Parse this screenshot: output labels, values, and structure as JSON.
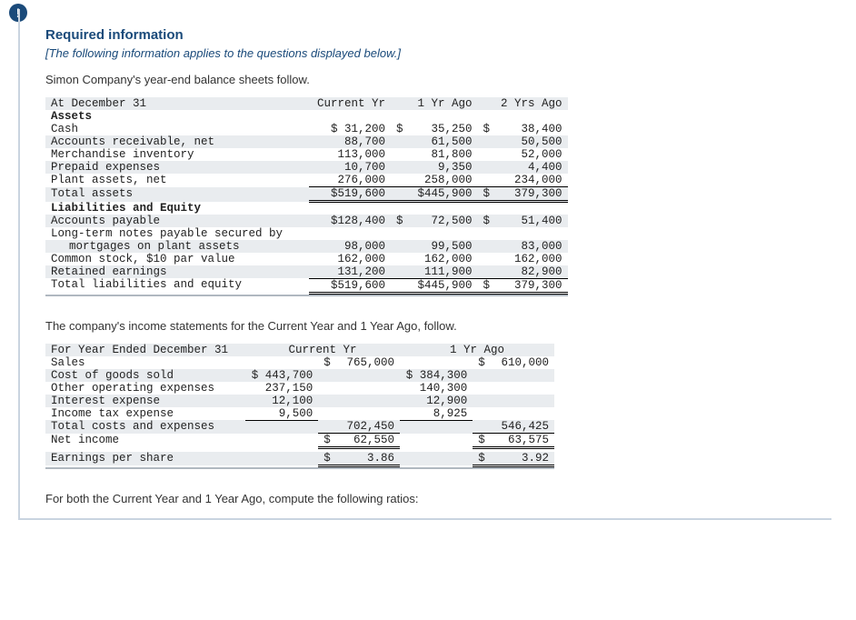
{
  "icon": "!",
  "title": "Required information",
  "intro": "[The following information applies to the questions displayed below.]",
  "lead1": "Simon Company's year-end balance sheets follow.",
  "bs": {
    "header": "At December 31",
    "cols": {
      "c1": "Current Yr",
      "c2": "1 Yr Ago",
      "c3": "2 Yrs Ago"
    },
    "assets_hdr": "Assets",
    "cash_lbl": "Cash",
    "cash": {
      "c1": "31,200",
      "c2": "35,250",
      "c3": "38,400"
    },
    "ar_lbl": "Accounts receivable, net",
    "ar": {
      "c1": "88,700",
      "c2": "61,500",
      "c3": "50,500"
    },
    "inv_lbl": "Merchandise inventory",
    "inv": {
      "c1": "113,000",
      "c2": "81,800",
      "c3": "52,000"
    },
    "pre_lbl": "Prepaid expenses",
    "pre": {
      "c1": "10,700",
      "c2": "9,350",
      "c3": "4,400"
    },
    "pa_lbl": "Plant assets, net",
    "pa": {
      "c1": "276,000",
      "c2": "258,000",
      "c3": "234,000"
    },
    "ta_lbl": "Total assets",
    "ta": {
      "c1": "$519,600",
      "c2": "$445,900",
      "c3": "379,300"
    },
    "le_hdr": "Liabilities and Equity",
    "ap_lbl": "Accounts payable",
    "ap": {
      "c1": "$128,400",
      "c2": "72,500",
      "c3": "51,400"
    },
    "ltn_lbl1": "Long-term notes payable secured by",
    "ltn_lbl2": "mortgages on plant assets",
    "ltn": {
      "c1": "98,000",
      "c2": "99,500",
      "c3": "83,000"
    },
    "cs_lbl": "Common stock, $10 par value",
    "cs": {
      "c1": "162,000",
      "c2": "162,000",
      "c3": "162,000"
    },
    "re_lbl": "Retained earnings",
    "re": {
      "c1": "131,200",
      "c2": "111,900",
      "c3": "82,900"
    },
    "tle_lbl": "Total liabilities and equity",
    "tle": {
      "c1": "$519,600",
      "c2": "$445,900",
      "c3": "379,300"
    }
  },
  "lead2": "The company's income statements for the Current Year and 1 Year Ago, follow.",
  "is": {
    "header": "For Year Ended December 31",
    "cols": {
      "c1": "Current Yr",
      "c2": "1 Yr Ago"
    },
    "sales_lbl": "Sales",
    "sales": {
      "c1": "765,000",
      "c2": "610,000"
    },
    "cogs_lbl": "Cost of goods sold",
    "cogs": {
      "c1": "443,700",
      "c2": "384,300"
    },
    "oox_lbl": "Other operating expenses",
    "oox": {
      "c1": "237,150",
      "c2": "140,300"
    },
    "int_lbl": "Interest expense",
    "int": {
      "c1": "12,100",
      "c2": "12,900"
    },
    "tax_lbl": "Income tax expense",
    "tax": {
      "c1": "9,500",
      "c2": "8,925"
    },
    "tce_lbl": "Total costs and expenses",
    "tce": {
      "c1": "702,450",
      "c2": "546,425"
    },
    "ni_lbl": "Net income",
    "ni": {
      "c1": "62,550",
      "c2": "63,575"
    },
    "eps_lbl": "Earnings per share",
    "eps": {
      "c1": "3.86",
      "c2": "3.92"
    }
  },
  "instr": "For both the Current Year and 1 Year Ago, compute the following ratios:"
}
